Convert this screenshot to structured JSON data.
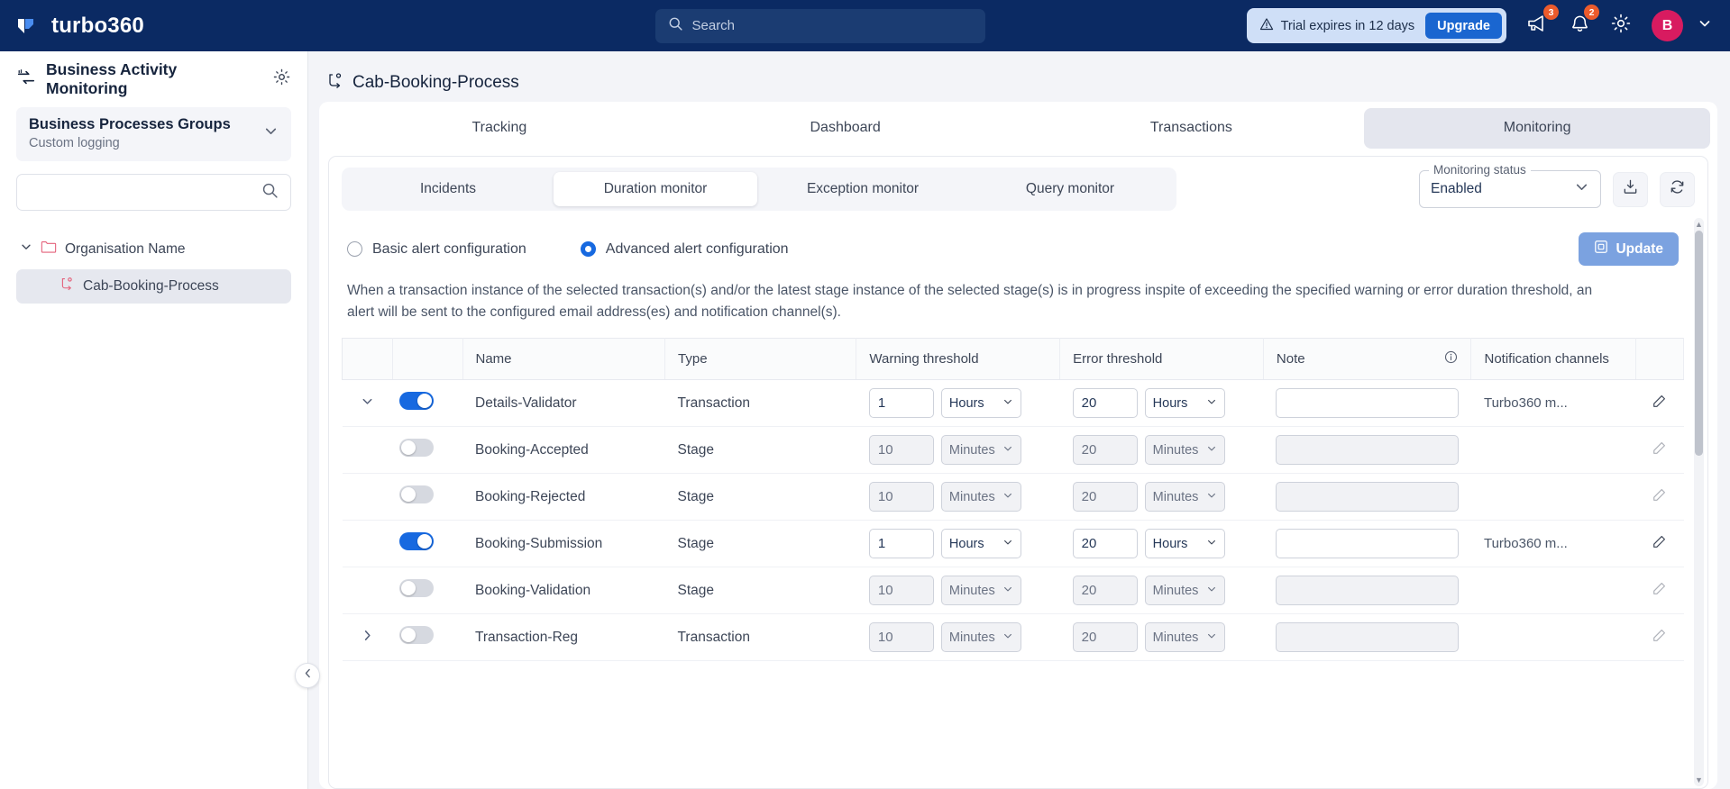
{
  "topbar": {
    "brand": "turbo360",
    "search_placeholder": "Search",
    "trial_text": "Trial expires in 12 days",
    "upgrade_label": "Upgrade",
    "announcements_badge": "3",
    "notifications_badge": "2",
    "avatar_initial": "B"
  },
  "sidebar": {
    "title": "Business Activity Monitoring",
    "group": {
      "title": "Business Processes Groups",
      "subtitle": "Custom logging"
    },
    "search_placeholder": "",
    "search_value": "",
    "tree": {
      "root_label": "Organisation Name",
      "child_label": "Cab-Booking-Process"
    }
  },
  "page": {
    "title": "Cab-Booking-Process",
    "tabs": [
      {
        "label": "Tracking",
        "active": false
      },
      {
        "label": "Dashboard",
        "active": false
      },
      {
        "label": "Transactions",
        "active": false
      },
      {
        "label": "Monitoring",
        "active": true
      }
    ],
    "subtabs": [
      {
        "label": "Incidents",
        "active": false
      },
      {
        "label": "Duration monitor",
        "active": true
      },
      {
        "label": "Exception monitor",
        "active": false
      },
      {
        "label": "Query monitor",
        "active": false
      }
    ],
    "monitoring_status": {
      "legend": "Monitoring status",
      "value": "Enabled"
    },
    "download_icon": "download-icon",
    "refresh_icon": "refresh-icon"
  },
  "alert_config": {
    "basic_label": "Basic alert configuration",
    "advanced_label": "Advanced alert configuration",
    "selected": "advanced",
    "update_label": "Update",
    "description": "When a transaction instance of the selected transaction(s) and/or the latest stage instance of the selected stage(s) is in progress inspite of exceeding the specified warning or error duration threshold, an alert will be sent to the configured email address(es) and notification channel(s)."
  },
  "table": {
    "headers": {
      "name": "Name",
      "type": "Type",
      "warning": "Warning threshold",
      "error": "Error threshold",
      "note": "Note",
      "channels": "Notification channels"
    },
    "note_info_icon": "info-icon",
    "rows": [
      {
        "expander": "chevron-down",
        "enabled": true,
        "name": "Details-Validator",
        "type": "Transaction",
        "warning_value": "1",
        "warning_unit": "Hours",
        "error_value": "20",
        "error_unit": "Hours",
        "note": "",
        "channels": "Turbo360 m..."
      },
      {
        "expander": "",
        "enabled": false,
        "name": "Booking-Accepted",
        "type": "Stage",
        "warning_value": "10",
        "warning_unit": "Minutes",
        "error_value": "20",
        "error_unit": "Minutes",
        "note": "",
        "channels": ""
      },
      {
        "expander": "",
        "enabled": false,
        "name": "Booking-Rejected",
        "type": "Stage",
        "warning_value": "10",
        "warning_unit": "Minutes",
        "error_value": "20",
        "error_unit": "Minutes",
        "note": "",
        "channels": ""
      },
      {
        "expander": "",
        "enabled": true,
        "name": "Booking-Submission",
        "type": "Stage",
        "warning_value": "1",
        "warning_unit": "Hours",
        "error_value": "20",
        "error_unit": "Hours",
        "note": "",
        "channels": "Turbo360 m..."
      },
      {
        "expander": "",
        "enabled": false,
        "name": "Booking-Validation",
        "type": "Stage",
        "warning_value": "10",
        "warning_unit": "Minutes",
        "error_value": "20",
        "error_unit": "Minutes",
        "note": "",
        "channels": ""
      },
      {
        "expander": "chevron-right",
        "enabled": false,
        "name": "Transaction-Reg",
        "type": "Transaction",
        "warning_value": "10",
        "warning_unit": "Minutes",
        "error_value": "20",
        "error_unit": "Minutes",
        "note": "",
        "channels": ""
      }
    ]
  },
  "colors": {
    "brand_navy": "#0b2a63",
    "accent_blue": "#1769e0",
    "avatar_pink": "#d81b60",
    "badge_orange": "#ec5b2c"
  }
}
